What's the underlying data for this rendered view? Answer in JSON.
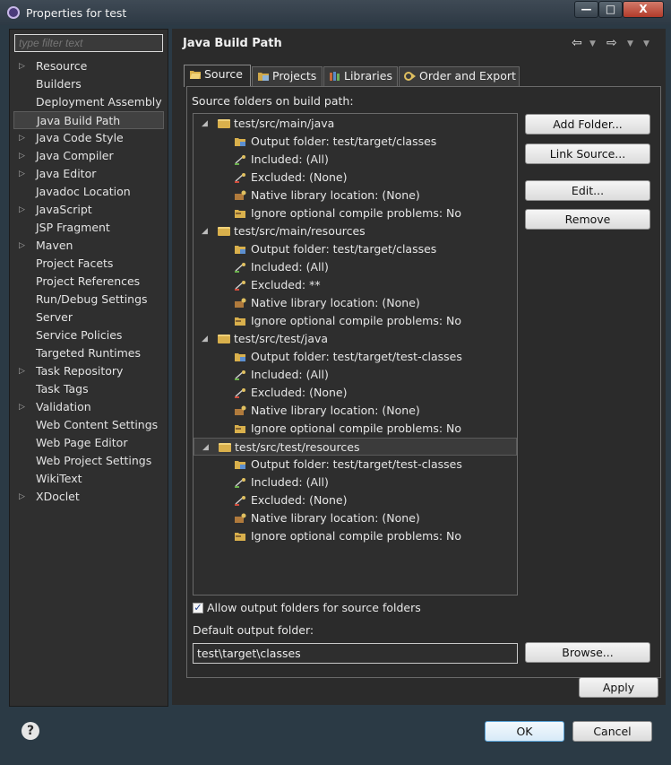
{
  "window": {
    "title": "Properties for test",
    "min_label": "—",
    "max_label": "□",
    "close_label": "X"
  },
  "filter": {
    "placeholder": "type filter text"
  },
  "nav": {
    "items": [
      {
        "label": "Resource",
        "expandable": true
      },
      {
        "label": "Builders",
        "expandable": false
      },
      {
        "label": "Deployment Assembly",
        "expandable": false
      },
      {
        "label": "Java Build Path",
        "expandable": false,
        "selected": true
      },
      {
        "label": "Java Code Style",
        "expandable": true
      },
      {
        "label": "Java Compiler",
        "expandable": true
      },
      {
        "label": "Java Editor",
        "expandable": true
      },
      {
        "label": "Javadoc Location",
        "expandable": false
      },
      {
        "label": "JavaScript",
        "expandable": true
      },
      {
        "label": "JSP Fragment",
        "expandable": false
      },
      {
        "label": "Maven",
        "expandable": true
      },
      {
        "label": "Project Facets",
        "expandable": false
      },
      {
        "label": "Project References",
        "expandable": false
      },
      {
        "label": "Run/Debug Settings",
        "expandable": false
      },
      {
        "label": "Server",
        "expandable": false
      },
      {
        "label": "Service Policies",
        "expandable": false
      },
      {
        "label": "Targeted Runtimes",
        "expandable": false
      },
      {
        "label": "Task Repository",
        "expandable": true
      },
      {
        "label": "Task Tags",
        "expandable": false
      },
      {
        "label": "Validation",
        "expandable": true
      },
      {
        "label": "Web Content Settings",
        "expandable": false
      },
      {
        "label": "Web Page Editor",
        "expandable": false
      },
      {
        "label": "Web Project Settings",
        "expandable": false
      },
      {
        "label": "WikiText",
        "expandable": false
      },
      {
        "label": "XDoclet",
        "expandable": true
      }
    ]
  },
  "page": {
    "title": "Java Build Path"
  },
  "tabs": [
    {
      "label": "Source",
      "active": true,
      "icon": "source-folder-icon"
    },
    {
      "label": "Projects",
      "active": false,
      "icon": "project-icon"
    },
    {
      "label": "Libraries",
      "active": false,
      "icon": "library-icon"
    },
    {
      "label": "Order and Export",
      "active": false,
      "icon": "order-icon"
    }
  ],
  "source": {
    "label": "Source folders on build path:",
    "folders": [
      {
        "path": "test/src/main/java",
        "children": [
          "Output folder: test/target/classes",
          "Included: (All)",
          "Excluded: (None)",
          "Native library location: (None)",
          "Ignore optional compile problems: No"
        ]
      },
      {
        "path": "test/src/main/resources",
        "children": [
          "Output folder: test/target/classes",
          "Included: (All)",
          "Excluded: **",
          "Native library location: (None)",
          "Ignore optional compile problems: No"
        ]
      },
      {
        "path": "test/src/test/java",
        "children": [
          "Output folder: test/target/test-classes",
          "Included: (All)",
          "Excluded: (None)",
          "Native library location: (None)",
          "Ignore optional compile problems: No"
        ]
      },
      {
        "path": "test/src/test/resources",
        "highlighted": true,
        "children": [
          "Output folder: test/target/test-classes",
          "Included: (All)",
          "Excluded: (None)",
          "Native library location: (None)",
          "Ignore optional compile problems: No"
        ]
      }
    ],
    "child_icons": [
      "output-folder-icon",
      "included-icon",
      "excluded-icon",
      "native-library-icon",
      "ignore-problems-icon"
    ],
    "buttons": {
      "add_folder": "Add Folder...",
      "link_source": "Link Source...",
      "edit": "Edit...",
      "remove": "Remove"
    },
    "allow_output_label": "Allow output folders for source folders",
    "allow_output_checked": true,
    "default_output_label": "Default output folder:",
    "default_output_value": "test\\target\\classes",
    "browse": "Browse..."
  },
  "footer": {
    "apply": "Apply",
    "ok": "OK",
    "cancel": "Cancel",
    "help_glyph": "?"
  },
  "header_nav": {
    "back_glyph": "⇦",
    "forward_glyph": "⇨",
    "dropdown_glyph": "▼",
    "menu_glyph": "▼"
  }
}
